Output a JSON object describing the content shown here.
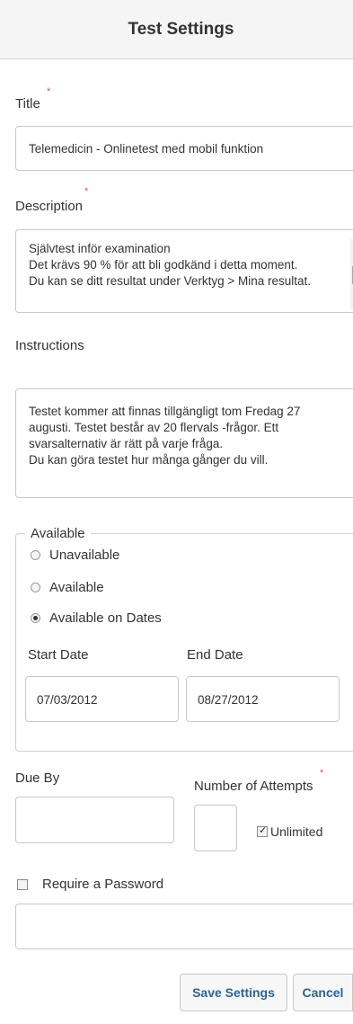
{
  "header": {
    "title": "Test Settings"
  },
  "form": {
    "title": {
      "label": "Title",
      "required_mark": "*",
      "value": "Telemedicin - Onlinetest med mobil funktion"
    },
    "description": {
      "label": "Description",
      "required_mark": "*",
      "value": "Självtest inför examination\nDet krävs 90 % för att bli godkänd i detta moment.\nDu kan se ditt resultat under Verktyg > Mina resultat."
    },
    "instructions": {
      "label": "Instructions",
      "value": "Testet kommer att finnas tillgängligt tom Fredag 27\naugusti. Testet består av 20 flervals -frågor. Ett\nsvarsalternativ är rätt på varje fråga.\nDu kan göra testet hur många gånger du vill."
    },
    "availability": {
      "legend": "Available",
      "options": [
        {
          "label": "Unavailable",
          "checked": false
        },
        {
          "label": "Available",
          "checked": false
        },
        {
          "label": "Available on Dates",
          "checked": true
        }
      ],
      "start_date": {
        "label": "Start Date",
        "value": "07/03/2012"
      },
      "end_date": {
        "label": "End Date",
        "value": "08/27/2012"
      }
    },
    "due_by": {
      "label": "Due By",
      "value": ""
    },
    "attempts": {
      "label": "Number of Attempts",
      "required_mark": "*",
      "value": "",
      "unlimited_label": "Unlimited",
      "unlimited_checked": true
    },
    "password": {
      "label": "Require a Password",
      "checked": false,
      "value": ""
    }
  },
  "buttons": {
    "save": "Save Settings",
    "cancel": "Cancel"
  },
  "colors": {
    "required": "#e5533d",
    "button_text": "#2a6496",
    "header_bg": "#f5f5f5"
  }
}
